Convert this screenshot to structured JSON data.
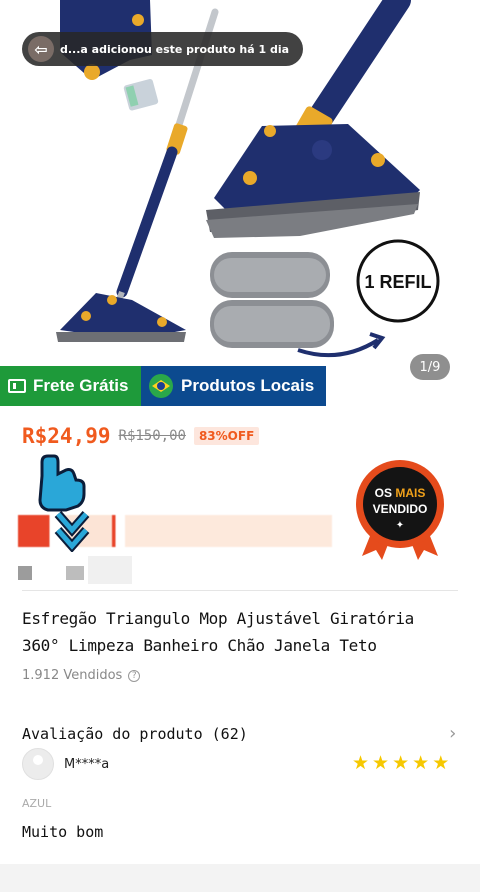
{
  "notification": {
    "text": "d...a adicionou este produto há 1 dia"
  },
  "gallery": {
    "refil_label": "1 REFIL",
    "counter": "1/9"
  },
  "badges": {
    "frete": "Frete Grátis",
    "local": "Produtos Locais"
  },
  "price": {
    "current": "R$24,99",
    "original": "R$150,00",
    "discount": "83%OFF"
  },
  "seal": {
    "line1": "OS",
    "highlight": "MAIS",
    "line2": "VENDIDO"
  },
  "product": {
    "title": "Esfregão Triangulo Mop Ajustável Giratória 360° Limpeza Banheiro Chão Janela Teto",
    "sold": "1.912 Vendidos"
  },
  "review": {
    "heading": "Avaliação do produto (62)",
    "reviewer": "M****a",
    "rating": 5,
    "variant": "AZUL",
    "comment": "Muito bom"
  },
  "colors": {
    "accent": "#f05a1e",
    "frete_green": "#1e9a3a",
    "local_blue": "#0c4a8f",
    "mop_navy": "#1f2f6e",
    "mop_yellow": "#e9a92a",
    "star": "#f6c800"
  }
}
